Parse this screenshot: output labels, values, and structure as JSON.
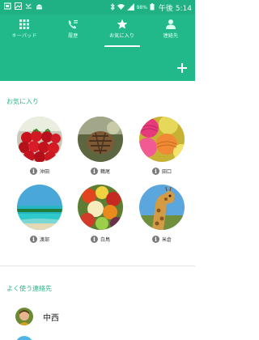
{
  "status_bar": {
    "signal_text": "🙌",
    "battery_percent": "98%",
    "time": "午後 5:14"
  },
  "tabs": [
    {
      "label": "キーパッド",
      "icon": "keypad-icon"
    },
    {
      "label": "履歴",
      "icon": "call-log-icon"
    },
    {
      "label": "お気に入り",
      "icon": "star-icon"
    },
    {
      "label": "連絡先",
      "icon": "person-icon"
    }
  ],
  "active_tab": "お気に入り",
  "add_button_label": "+",
  "favorites": {
    "label": "お気に入り",
    "items": [
      {
        "name": "沖田",
        "avatar": "strawberries"
      },
      {
        "name": "鶴尾",
        "avatar": "pinecone"
      },
      {
        "name": "田口",
        "avatar": "yarn"
      },
      {
        "name": "渡部",
        "avatar": "beach"
      },
      {
        "name": "白鳥",
        "avatar": "fruit"
      },
      {
        "name": "米倉",
        "avatar": "giraffe"
      }
    ]
  },
  "frequent": {
    "label": "よく使う連絡先",
    "items": [
      {
        "name": "中西",
        "avatar": "child"
      }
    ]
  },
  "colors": {
    "accent": "#21b98a",
    "status_bar": "#1fb083",
    "section_label": "#2fb48a"
  }
}
